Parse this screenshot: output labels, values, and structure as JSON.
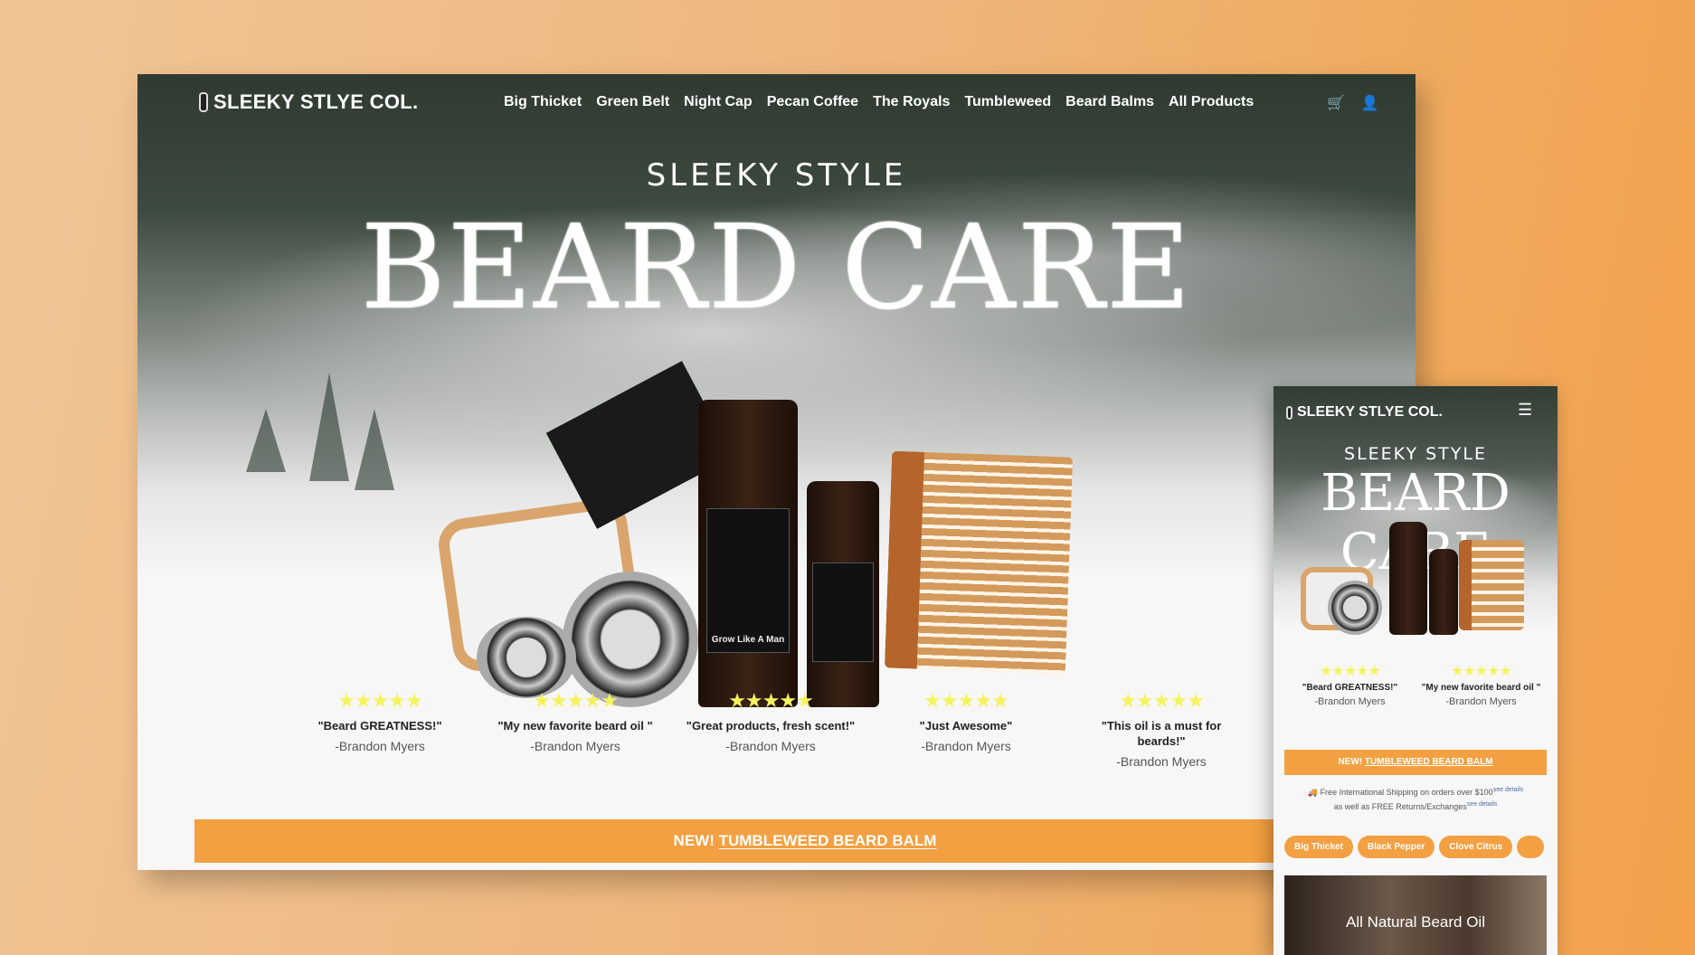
{
  "brand": "SLEEKY STLYE COL.",
  "nav": {
    "items": [
      "Big Thicket",
      "Green Belt",
      "Night Cap",
      "Pecan Coffee",
      "The Royals",
      "Tumbleweed",
      "Beard Balms",
      "All Products"
    ],
    "icons": [
      "cart-icon",
      "user-icon"
    ]
  },
  "hero": {
    "subtitle": "SLEEKY STYLE",
    "title": "BEARD CARE",
    "product_label": "Grow Like A Man"
  },
  "reviews": [
    {
      "rating": 5,
      "quote": "\"Beard GREATNESS!\"",
      "author": "-Brandon Myers"
    },
    {
      "rating": 5,
      "quote": "\"My new favorite beard oil \"",
      "author": "-Brandon Myers"
    },
    {
      "rating": 5,
      "quote": "\"Great products, fresh scent!\"",
      "author": "-Brandon Myers"
    },
    {
      "rating": 5,
      "quote": "\"Just Awesome\"",
      "author": "-Brandon Myers"
    },
    {
      "rating": 5,
      "quote": "\"This oil is a must for beards!\"",
      "author": "-Brandon Myers"
    }
  ],
  "banner": {
    "prefix": "NEW!",
    "link": "TUMBLEWEED BEARD BALM"
  },
  "mobile": {
    "shipping_line1": "Free International Shipping on orders over $100",
    "shipping_line2": "as well as FREE Returns/Exchanges",
    "see_details": "see details",
    "pills": [
      "Big Thicket",
      "Black Pepper",
      "Clove Citrus"
    ],
    "feature": "All Natural Beard Oil"
  },
  "colors": {
    "accent": "#f3a042",
    "stars": "#f4f35d"
  }
}
